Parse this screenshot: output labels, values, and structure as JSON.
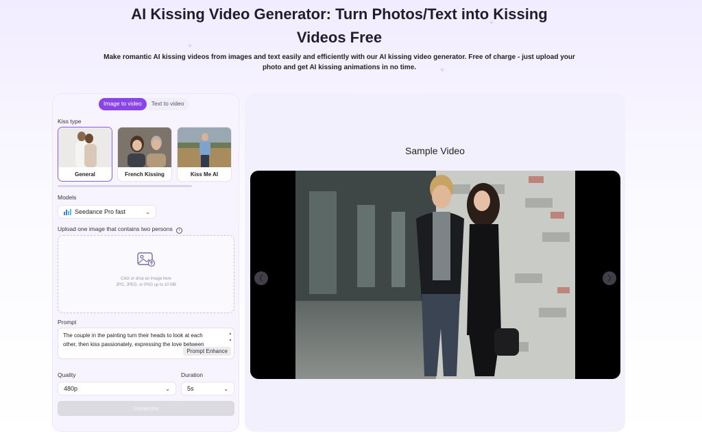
{
  "hero": {
    "title_line1": "AI Kissing Video Generator: Turn Photos/Text into Kissing",
    "title_line2": "Videos Free",
    "subtitle_line1": "Make romantic AI kissing videos from images and text easily and efficiently with our AI kissing video generator. Free of charge - just upload your",
    "subtitle_line2": "photo and get AI kissing animations in no time."
  },
  "mode_tabs": [
    {
      "label": "Image to video",
      "active": true
    },
    {
      "label": "Text to video",
      "active": false
    }
  ],
  "kiss_type": {
    "label": "Kiss type",
    "options": [
      {
        "label": "General",
        "selected": true
      },
      {
        "label": "French Kissing",
        "selected": false
      },
      {
        "label": "Kiss Me AI",
        "selected": false
      }
    ]
  },
  "models": {
    "label": "Models",
    "selected": "Seedance Pro fast"
  },
  "upload": {
    "label": "Upload one image that contains two persons",
    "hint_line1": "Click or drop an image here",
    "hint_line2": "JPG, JPEG, or PNG up to 10 MB"
  },
  "prompt": {
    "label": "Prompt",
    "value_line1": "The couple in the painting turn their heads to look at each",
    "value_line2": "other, then kiss passionately, expressing the love between",
    "enhance_label": "Prompt Enhance"
  },
  "quality": {
    "label": "Quality",
    "selected": "480p"
  },
  "duration": {
    "label": "Duration",
    "selected": "5s"
  },
  "generate_label": "Generate",
  "preview": {
    "title": "Sample Video"
  },
  "colors": {
    "accent": "#8a45e9",
    "panel": "#f3f0fd",
    "disabled": "#dcdbe2"
  }
}
